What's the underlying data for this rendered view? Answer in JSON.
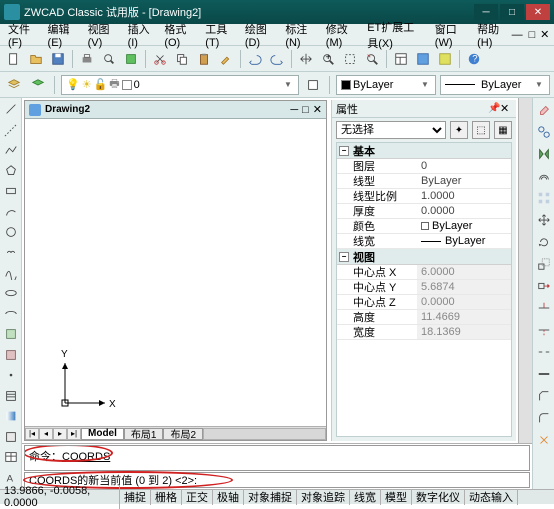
{
  "titlebar": {
    "app_title": "ZWCAD Classic 试用版 - [Drawing2]"
  },
  "menu": {
    "items": [
      "文件(F)",
      "编辑(E)",
      "视图(V)",
      "插入(I)",
      "格式(O)",
      "工具(T)",
      "绘图(D)",
      "标注(N)",
      "修改(M)",
      "ET扩展工具(X)",
      "窗口(W)",
      "帮助(H)"
    ]
  },
  "layerbar": {
    "layer0_label": "0",
    "bylayer1": "ByLayer",
    "bylayer2": "ByLayer"
  },
  "drawing": {
    "tab_title": "Drawing2",
    "model": "Model",
    "layout1": "布局1",
    "layout2": "布局2",
    "y_axis": "Y",
    "x_axis": "X"
  },
  "props": {
    "panel_title": "属性",
    "selection": "无选择",
    "sections": {
      "basic": "基本",
      "view": "视图"
    },
    "rows": [
      {
        "name": "图层",
        "val": "0",
        "dis": false
      },
      {
        "name": "线型",
        "val": "ByLayer",
        "dis": false
      },
      {
        "name": "线型比例",
        "val": "1.0000",
        "dis": false
      },
      {
        "name": "厚度",
        "val": "0.0000",
        "dis": false
      },
      {
        "name": "颜色",
        "val": "ByLayer",
        "dis": false,
        "swatch": "#fff"
      },
      {
        "name": "线宽",
        "val": "ByLayer",
        "dis": false,
        "line": true
      }
    ],
    "view_rows": [
      {
        "name": "中心点 X",
        "val": "6.0000",
        "dis": true
      },
      {
        "name": "中心点 Y",
        "val": "5.6874",
        "dis": true
      },
      {
        "name": "中心点 Z",
        "val": "0.0000",
        "dis": true
      },
      {
        "name": "高度",
        "val": "11.4669",
        "dis": true
      },
      {
        "name": "宽度",
        "val": "18.1369",
        "dis": true
      }
    ]
  },
  "cmd": {
    "hist_prefix": "命令：",
    "cmd_text": "COORDS",
    "prompt": "COORDS的新当前值 (0 到 2) <2>:"
  },
  "status": {
    "coords": "13.9866, -0.0058, 0.0000",
    "items": [
      "捕捉",
      "栅格",
      "正交",
      "极轴",
      "对象捕捉",
      "对象追踪",
      "线宽",
      "模型",
      "数字化仪",
      "动态输入"
    ]
  }
}
